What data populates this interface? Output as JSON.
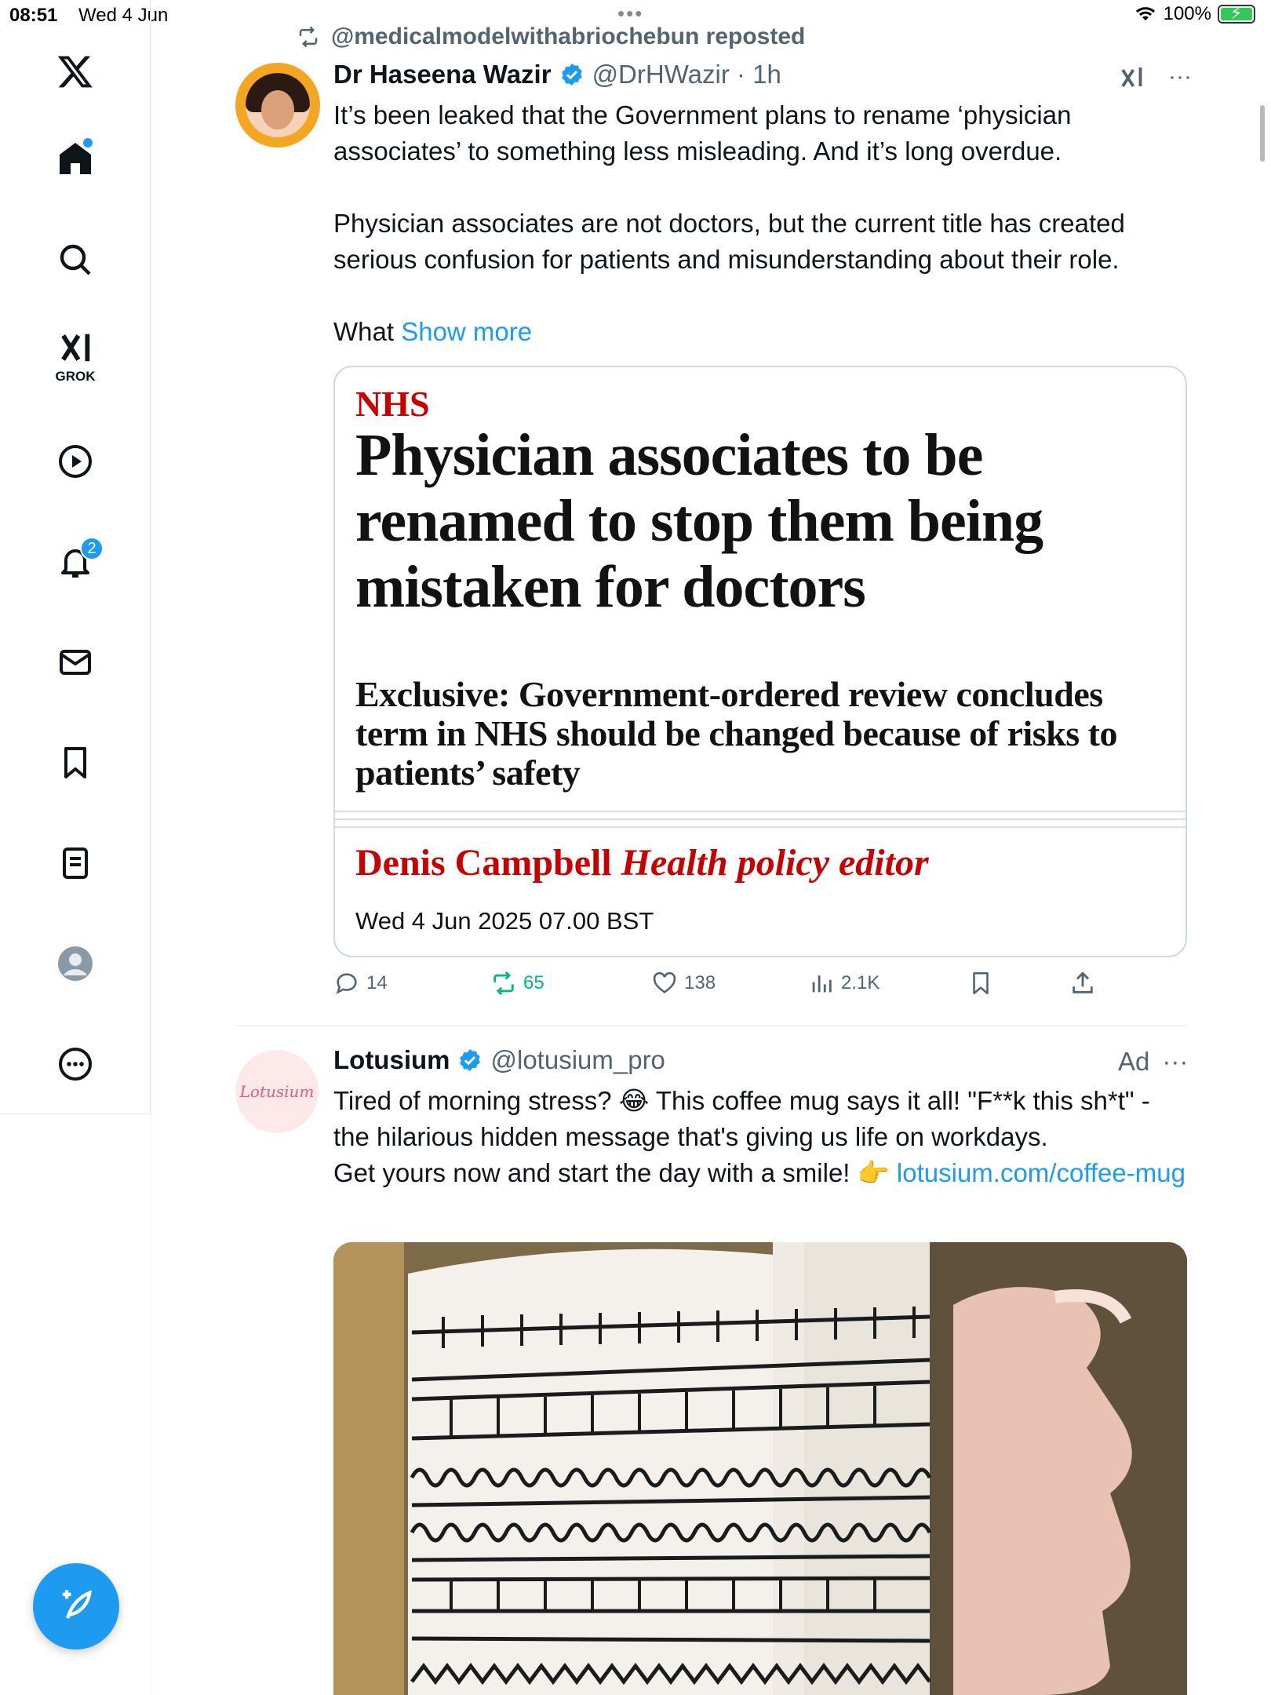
{
  "status_bar": {
    "time": "08:51",
    "date": "Wed 4 Jun",
    "battery": "100%"
  },
  "sidebar": {
    "grok_label": "GROK",
    "notification_count": "2"
  },
  "repost": {
    "label": "@medicalmodelwithabriochebun reposted"
  },
  "tweet": {
    "author_name": "Dr Haseena Wazir",
    "handle_time": "@DrHWazir · 1h",
    "more": "···",
    "paragraph1": "It’s been leaked that the Government plans to rename ‘physician associates’ to something less misleading. And it’s long overdue.",
    "paragraph2": "Physician associates are not doctors, but the current title has created serious confusion for patients and misunderstanding about their role.",
    "paragraph3_start": "What",
    "show_more": "Show more",
    "card": {
      "section": "NHS",
      "headline": "Physician associates to be renamed to stop them being mistaken for doctors",
      "standfirst": "Exclusive: Government-ordered review concludes term in NHS should be changed because of risks to patients’ safety",
      "author": "Denis Campbell",
      "role": "Health policy editor",
      "date": "Wed 4 Jun 2025 07.00 BST"
    },
    "actions": {
      "replies": "14",
      "reposts": "65",
      "likes": "138",
      "views": "2.1K"
    }
  },
  "ad": {
    "avatar_text": "Lotusium",
    "author_name": "Lotusium",
    "handle": "@lotusium_pro",
    "ad_label": "Ad",
    "more": "···",
    "line1": "Tired of morning stress? 😂 This coffee mug says it all! \"F**k this sh*t\" - the hilarious hidden message that's giving us life on workdays.",
    "line2": "Get yours now and start the day with a smile! 👉",
    "link": "lotusium.com/coffee-mug"
  },
  "colors": {
    "accent": "#1d9bf0",
    "repost_green": "#00ba7c",
    "guardian_red": "#c70000",
    "muted": "#536471"
  }
}
